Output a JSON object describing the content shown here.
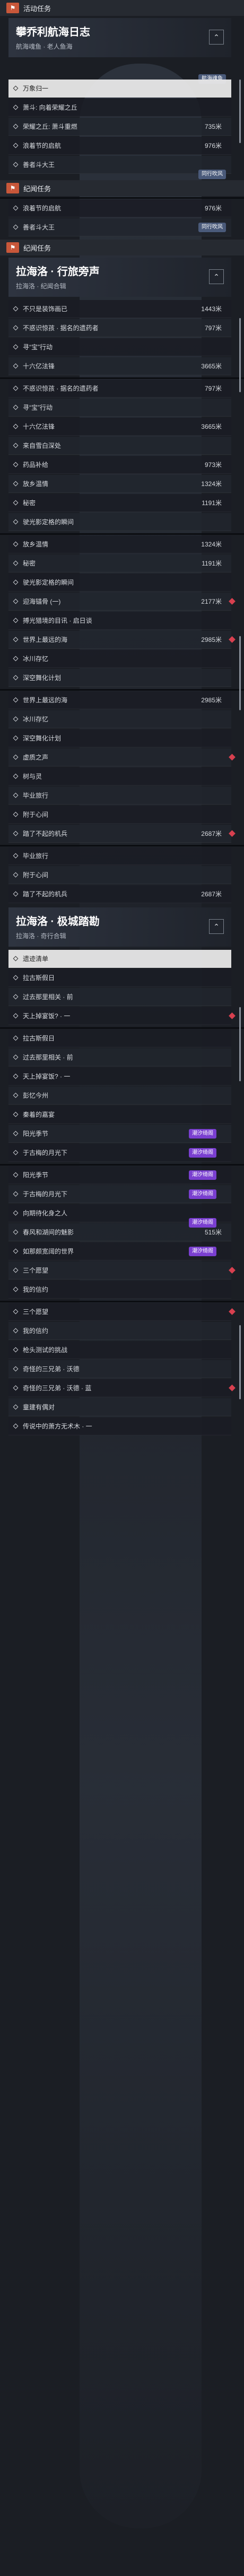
{
  "header": {
    "badge": "⚑",
    "title": "活动任务"
  },
  "section1": {
    "title": "攀乔利航海日志",
    "subtitle": "航海魂鱼 · 老人鱼海"
  },
  "labels": {
    "hai_yu": "航海魂鱼",
    "tong_xing": "同行吹风",
    "chao_xi": "潮汐绮阁",
    "main_tasks": "纪闻任务"
  },
  "section2": {
    "title": "拉海洛 · 行旅旁声",
    "subtitle": "拉海洛 · 纪闻合辑"
  },
  "section3": {
    "title": "拉海洛 · 极城踏勘",
    "subtitle": "拉海洛 · 奇行合辑"
  },
  "rows": {
    "r1": "万象归一",
    "r2": "萧斗: 向着荣耀之丘",
    "r3": "荣耀之丘: 萧斗重燃",
    "r3v": "735米",
    "r4": "浪着节的启航",
    "r4v": "976米",
    "r5": "善者斗大王",
    "r6": "浪着节的启航",
    "r6v": "976米",
    "r7": "善者斗大王",
    "a1": "不只是装饰画已",
    "a1v": "1443米",
    "a2": "不惑识惊孩 · 据名的遗药者",
    "a2v": "797米",
    "a3": "寻“宝”行动",
    "a4": "十六亿法锋",
    "a4v": "3665米",
    "a5": "不惑识惊孩 · 据名的遗药者",
    "a5v": "797米",
    "a6": "寻“宝”行动",
    "a7": "十六亿法锋",
    "a7v": "3665米",
    "a8": "来自雪白深处",
    "a9": "药品补给",
    "a9v": "973米",
    "a10": "放乡温情",
    "a10v": "1324米",
    "a11": "秘密",
    "a11v": "1191米",
    "a12": "驶光影定格的瞬间",
    "b1": "放乡温情",
    "b1v": "1324米",
    "b2": "秘密",
    "b2v": "1191米",
    "b3": "驶光影定格的瞬间",
    "b4": "迎海锚骨 (一)",
    "b4v": "2177米",
    "b5": "搏光猎境的目讯 · 启日谈",
    "b6": "世界上最远的海",
    "b6v": "2985米",
    "b7": "冰川存忆",
    "b8": "深空舞化计划",
    "c1": "世界上最远的海",
    "c1v": "2985米",
    "c2": "冰川存忆",
    "c3": "深空舞化计划",
    "c4": "虚质之声",
    "c5": "树与灵",
    "c6": "毕业旅行",
    "c7": "附于心间",
    "c8": "踏了不起的机兵",
    "c8v": "2687米",
    "d1": "毕业旅行",
    "d2": "附于心间",
    "d3": "踏了不起的机兵",
    "d3v": "2687米",
    "e1": "遗迹清单",
    "e2": "拉古斯假日",
    "e3": "过去那里相关 · 前",
    "e4": "天上掉宴饭? · 一",
    "f1": "拉古斯假日",
    "f2": "过去那里相关 · 前",
    "f3": "天上掉宴饭? · 一",
    "f4": "彭忆今州",
    "f5": "秦着的嘉宴",
    "f6": "阳光季节",
    "f7": "于古梅的月光下",
    "g1": "阳光季节",
    "g2": "于古梅的月光下",
    "g3": "向期待化身之人",
    "g4": "春风和湖间的魅影",
    "g4v": "515米",
    "g5": "如那颇宽阔的世界",
    "g6": "三个愿望",
    "g7": "我的信约",
    "h1": "三个愿望",
    "h2": "我的信约",
    "h3": "枪头测试的挑战",
    "h4": "奇怪的三兄弟 · 沃德",
    "h5": "奇怪的三兄弟 · 沃德 · 蓝",
    "h6": "童建有偶对",
    "h7": "传说中的萧方无术木 · 一"
  }
}
